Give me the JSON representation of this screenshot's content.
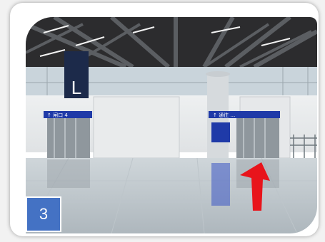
{
  "photo": {
    "description_icon": "airport-terminal-interior-icon",
    "zone_sign_letter": "L",
    "left_sign_text": "↑ 闸口 4",
    "right_sign_text": "↑ 通往 …",
    "arrow_color": "#e8141b",
    "sign_color": "#1f3aa8"
  },
  "badge": {
    "number": "3",
    "color": "#4472c4"
  }
}
